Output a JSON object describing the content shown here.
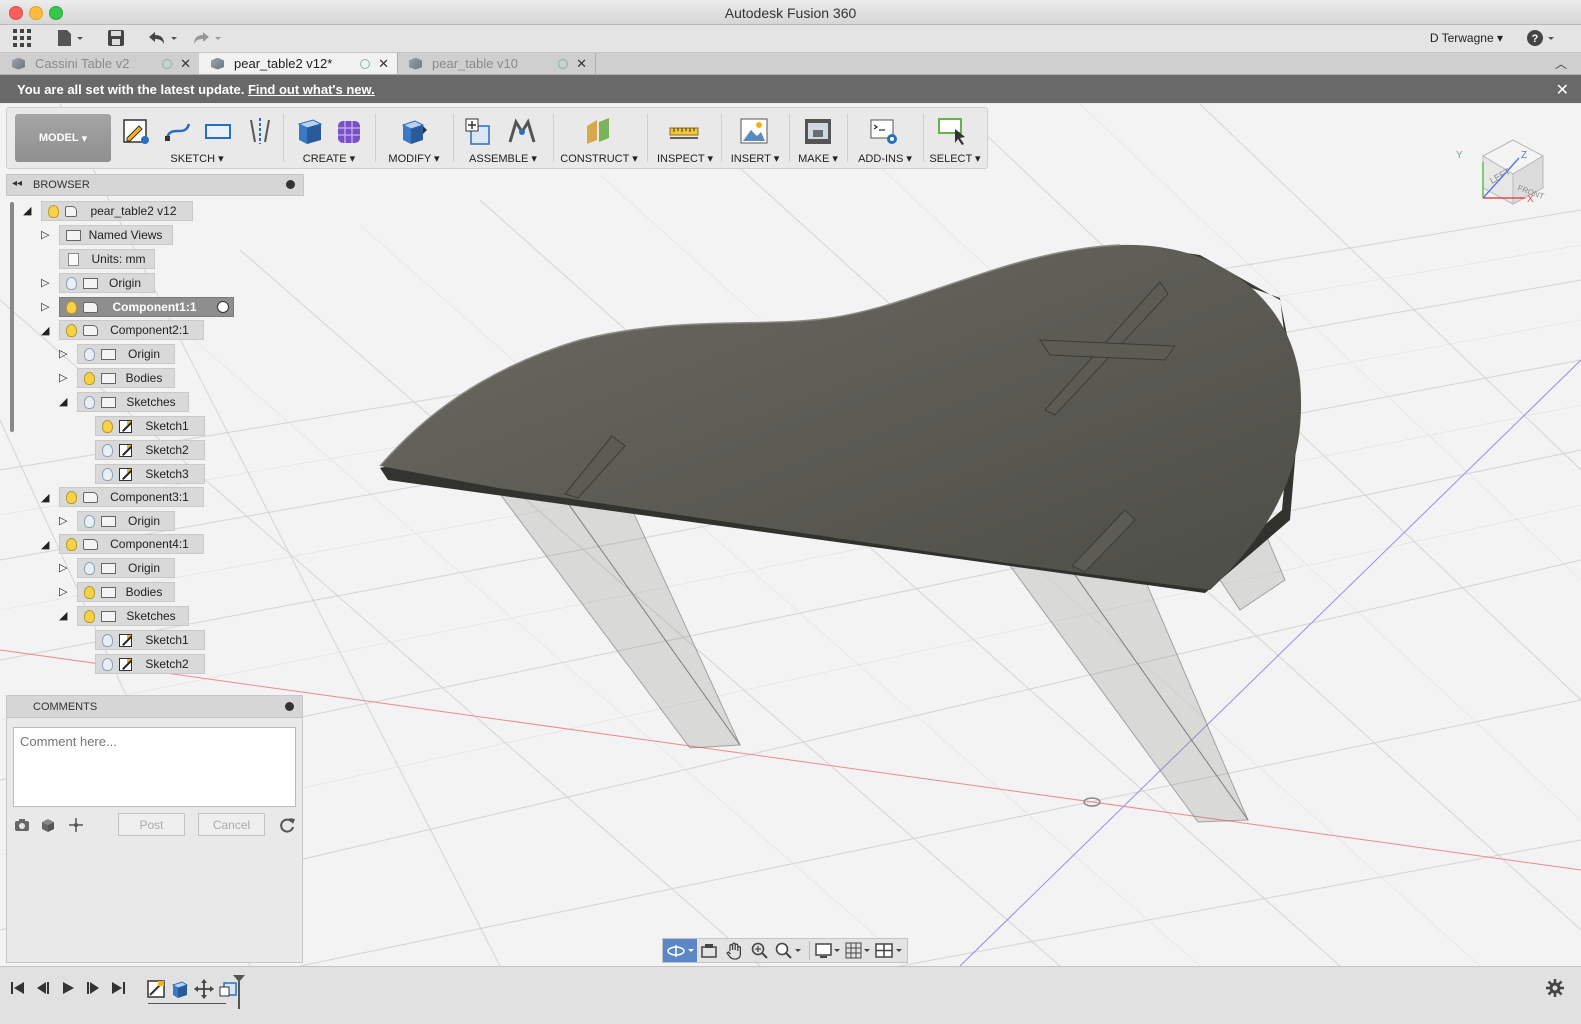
{
  "window": {
    "title": "Autodesk Fusion 360"
  },
  "app_toolbar": {
    "user": "D Terwagne"
  },
  "tabs": [
    {
      "label": "Cassini Table v2",
      "active": false
    },
    {
      "label": "pear_table2 v12*",
      "active": true
    },
    {
      "label": "pear_table v10",
      "active": false
    }
  ],
  "banner": {
    "message": "You are all set with the latest update.",
    "link": "Find out what's new."
  },
  "ribbon": {
    "mode": "MODEL",
    "groups": [
      "SKETCH",
      "CREATE",
      "MODIFY",
      "ASSEMBLE",
      "CONSTRUCT",
      "INSPECT",
      "INSERT",
      "MAKE",
      "ADD-INS",
      "SELECT"
    ]
  },
  "browser": {
    "title": "BROWSER",
    "root": "pear_table2 v12",
    "named_views": "Named Views",
    "units": "Units: mm",
    "origin": "Origin",
    "component1": "Component1:1",
    "component2": "Component2:1",
    "c2_origin": "Origin",
    "c2_bodies": "Bodies",
    "c2_sketches": "Sketches",
    "c2_sketch1": "Sketch1",
    "c2_sketch2": "Sketch2",
    "c2_sketch3": "Sketch3",
    "component3": "Component3:1",
    "c3_origin": "Origin",
    "component4": "Component4:1",
    "c4_origin": "Origin",
    "c4_bodies": "Bodies",
    "c4_sketches": "Sketches",
    "c4_sketch1": "Sketch1",
    "c4_sketch2": "Sketch2"
  },
  "comments": {
    "title": "COMMENTS",
    "placeholder": "Comment here...",
    "post": "Post",
    "cancel": "Cancel"
  },
  "viewcube": {
    "face_left": "LEFT",
    "face_front": "FRONT",
    "axis_x": "X",
    "axis_y": "Y",
    "axis_z": "Z"
  },
  "colors": {
    "accent": "#5b87c6",
    "banner": "#696969",
    "ribbon_bg": "#e9e9e9"
  }
}
